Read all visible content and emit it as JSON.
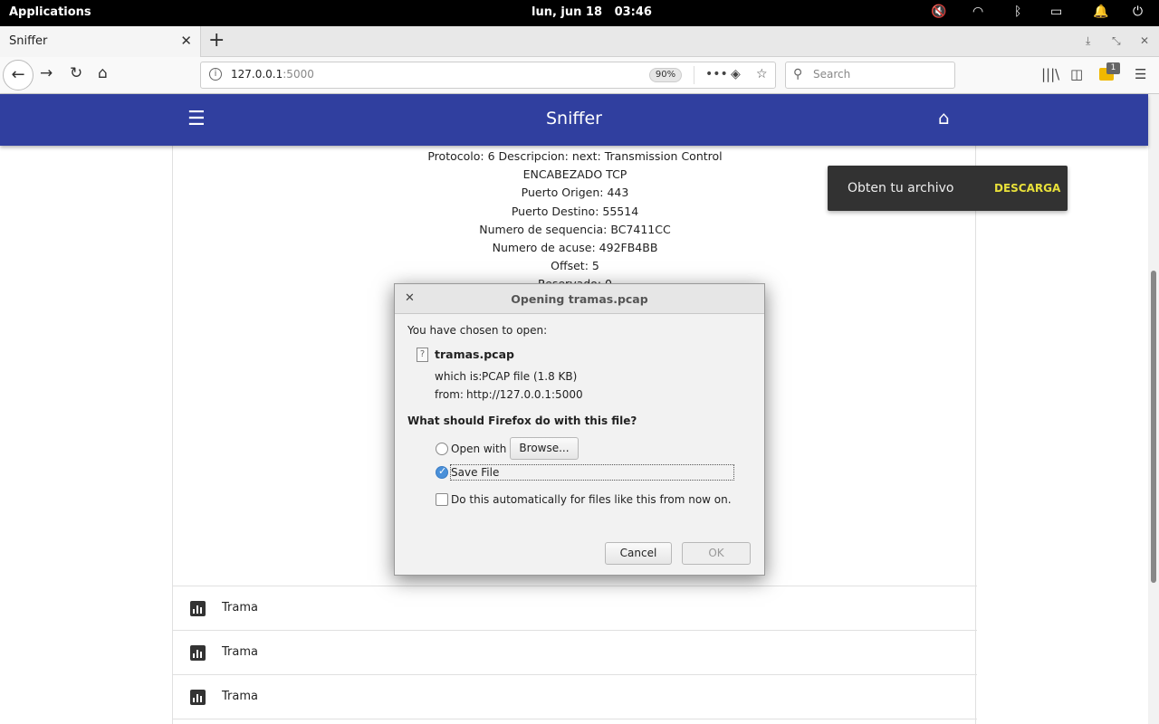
{
  "system_bar": {
    "applications_label": "Applications",
    "datetime": "lun, jun 18   03:46",
    "icons": [
      "volume-muted-icon",
      "wifi-icon",
      "bluetooth-icon",
      "battery-icon",
      "bell-icon",
      "power-icon"
    ]
  },
  "browser": {
    "tab_title": "Sniffer",
    "url_host": "127.0.0.1",
    "url_port": ":5000",
    "zoom": "90%",
    "search_placeholder": "Search",
    "extension_badge": "1"
  },
  "app": {
    "title": "Sniffer",
    "detail_lines": [
      "Protocolo: 6 Descripcion: next: Transmission Control",
      "ENCABEZADO TCP",
      "Puerto Origen: 443",
      "Puerto Destino: 55514",
      "Numero de sequencia: BC7411CC",
      "Numero de acuse: 492FB4BB",
      "Offset: 5",
      "Reservado: 0"
    ],
    "list_items": [
      "Trama",
      "Trama",
      "Trama"
    ]
  },
  "snackbar": {
    "message": "Obten tu archivo",
    "action": "DESCARGA",
    "action_color": "#e8e03a"
  },
  "dialog": {
    "title": "Opening tramas.pcap",
    "intro": "You have chosen to open:",
    "file_name": "tramas.pcap",
    "which_is_label": "which is:",
    "which_is_value": "PCAP file (1.8 KB)",
    "from_label": "from:",
    "from_value": "http://127.0.0.1:5000",
    "question": "What should Firefox do with this file?",
    "open_with_label": "Open with",
    "browse_label": "Browse...",
    "save_file_label": "Save File",
    "auto_label": "Do this automatically for files like this from now on.",
    "cancel_label": "Cancel",
    "ok_label": "OK",
    "selected_option": "Save File"
  },
  "colors": {
    "appbar": "#303f9f",
    "snackbar_bg": "#323232"
  }
}
